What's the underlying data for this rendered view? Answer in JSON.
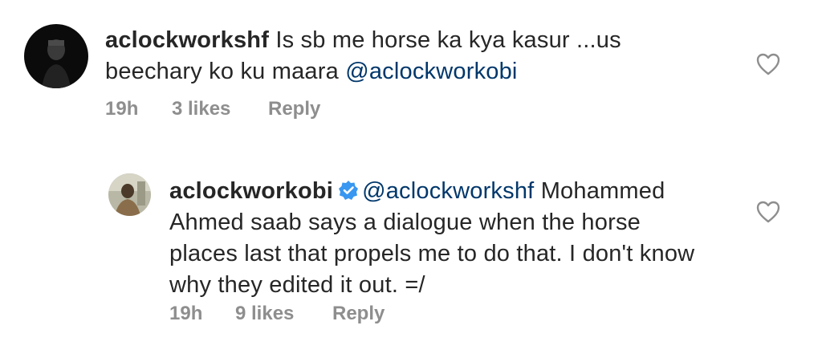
{
  "comments": [
    {
      "username": "aclockworkshf",
      "text": "Is sb me horse ka kya kasur ...us beechary ko ku maara",
      "mention": "@aclockworkobi",
      "time": "19h",
      "likes": "3 likes",
      "reply": "Reply",
      "verified": false
    },
    {
      "username": "aclockworkobi",
      "mention": "@aclockworkshf",
      "text": "Mohammed Ahmed saab says a dialogue when the horse places last that propels me to do that. I don't know why they edited it out. =/",
      "time": "19h",
      "likes": "9 likes",
      "reply": "Reply",
      "verified": true
    }
  ],
  "colors": {
    "text": "#262626",
    "mention": "#00376b",
    "meta": "#8e8e8e",
    "verified": "#3897f0"
  },
  "icons": {
    "like": "heart-outline-icon",
    "verified": "verified-badge-icon"
  }
}
